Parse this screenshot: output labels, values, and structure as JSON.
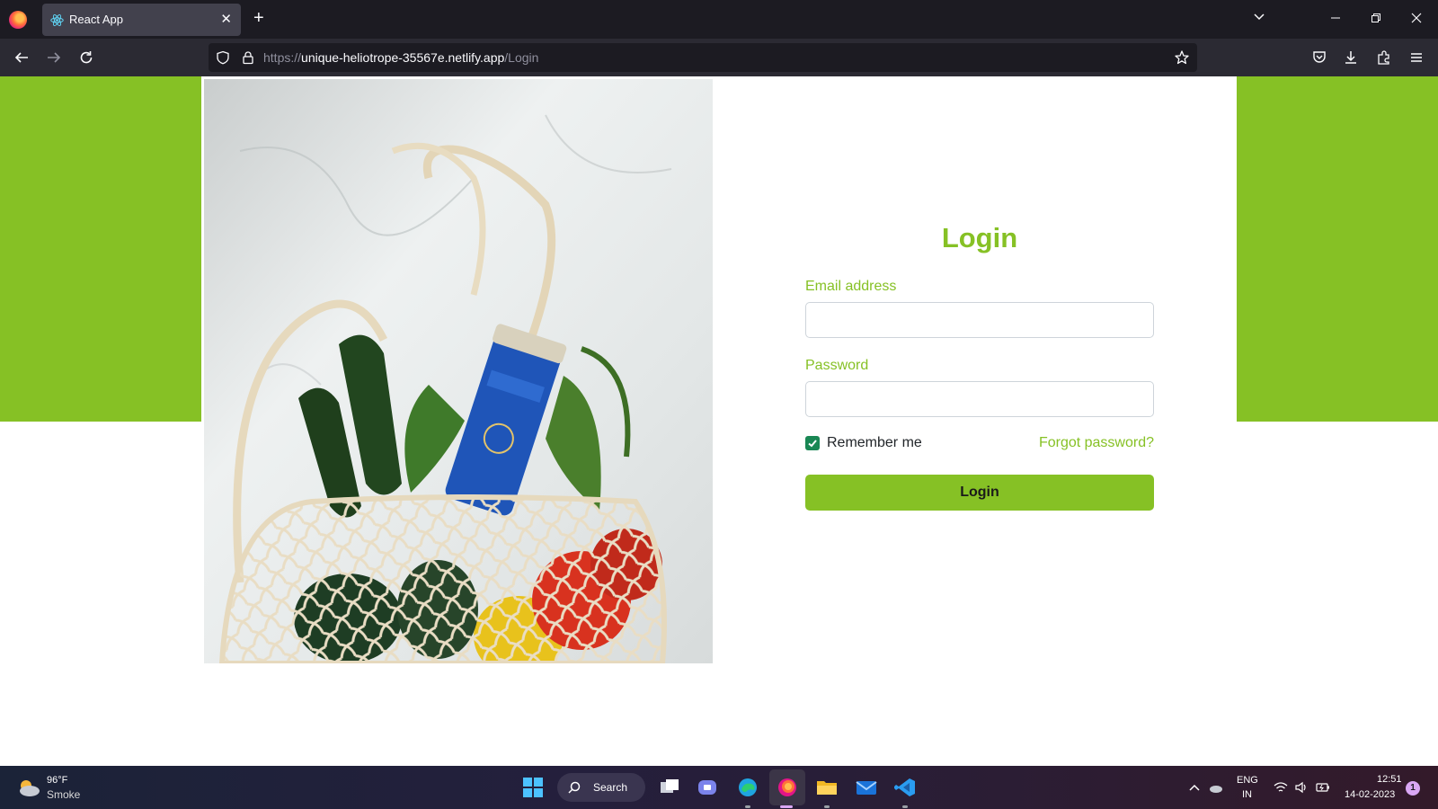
{
  "browser": {
    "tab_title": "React App",
    "url_prefix": "https://",
    "url_host": "unique-heliotrope-35567e.netlify.app",
    "url_path": "/Login"
  },
  "page": {
    "title": "Login",
    "email_label": "Email address",
    "email_value": "",
    "password_label": "Password",
    "password_value": "",
    "remember_label": "Remember me",
    "remember_checked": true,
    "forgot_link": "Forgot password?",
    "login_button": "Login",
    "hero_image": "grocery-bag-photo",
    "colors": {
      "accent": "#86c125",
      "checkbox": "#198754"
    }
  },
  "taskbar": {
    "weather_temp": "96°F",
    "weather_condition": "Smoke",
    "search_label": "Search",
    "lang_line1": "ENG",
    "lang_line2": "IN",
    "time": "12:51",
    "date": "14-02-2023",
    "notification_count": "1"
  }
}
